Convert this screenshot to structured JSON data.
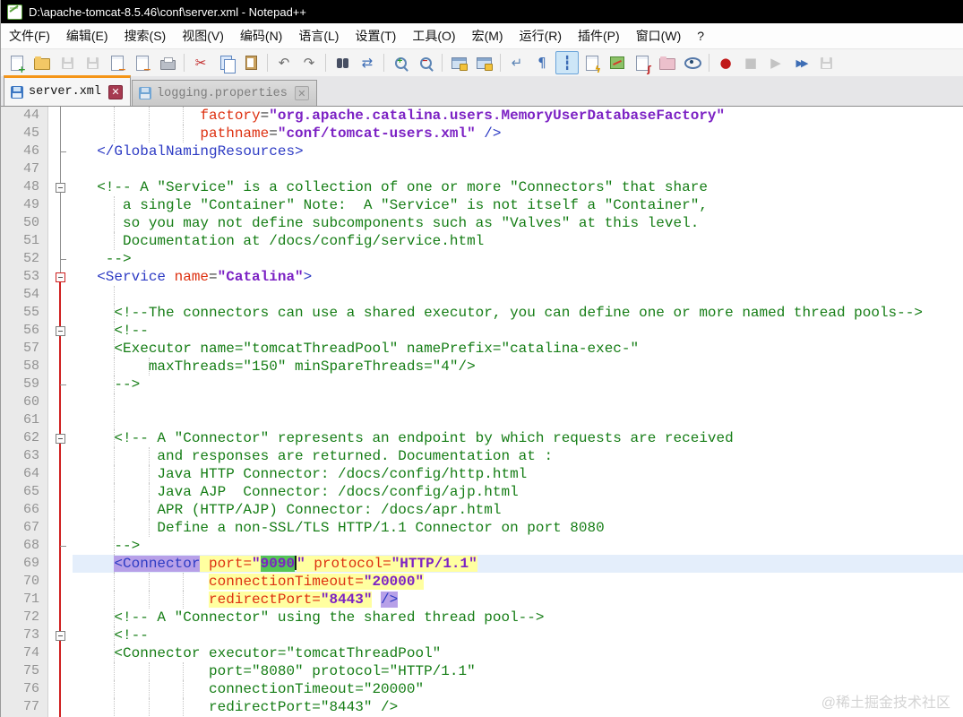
{
  "window": {
    "title": "D:\\apache-tomcat-8.5.46\\conf\\server.xml - Notepad++"
  },
  "menu": {
    "items": [
      "文件(F)",
      "编辑(E)",
      "搜索(S)",
      "视图(V)",
      "编码(N)",
      "语言(L)",
      "设置(T)",
      "工具(O)",
      "宏(M)",
      "运行(R)",
      "插件(P)",
      "窗口(W)",
      "?"
    ]
  },
  "toolbar": {
    "icons": [
      {
        "name": "new-file",
        "kind": "page",
        "glyph": "+",
        "color": "#2f9e2f"
      },
      {
        "name": "open-file",
        "kind": "folder",
        "color": "#f3c865",
        "border": "#b08a2e"
      },
      {
        "name": "save",
        "kind": "floppy",
        "color": "#9aa2ae",
        "disabled": true
      },
      {
        "name": "save-all",
        "kind": "floppy",
        "color": "#9aa2ae",
        "disabled": true
      },
      {
        "name": "close",
        "kind": "page",
        "glyph": "−",
        "color": "#e07818"
      },
      {
        "name": "close-all",
        "kind": "page",
        "glyph": "−",
        "color": "#e07818"
      },
      {
        "name": "print",
        "kind": "printer"
      },
      {
        "kind": "sep"
      },
      {
        "name": "cut",
        "kind": "glyph",
        "glyph": "✂",
        "color": "#c22727"
      },
      {
        "name": "copy",
        "kind": "page2"
      },
      {
        "name": "paste",
        "kind": "clip"
      },
      {
        "kind": "sep"
      },
      {
        "name": "undo",
        "kind": "glyph",
        "glyph": "↶",
        "color": "#6e6e6e"
      },
      {
        "name": "redo",
        "kind": "glyph",
        "glyph": "↷",
        "color": "#6e6e6e"
      },
      {
        "kind": "sep"
      },
      {
        "name": "find",
        "kind": "binoc"
      },
      {
        "name": "replace",
        "kind": "glyph",
        "glyph": "⇄",
        "color": "#3d6db5"
      },
      {
        "kind": "sep"
      },
      {
        "name": "zoom-in",
        "kind": "mag",
        "glyph": "+",
        "color": "#2f9e2f"
      },
      {
        "name": "zoom-out",
        "kind": "mag",
        "glyph": "−",
        "color": "#c22727"
      },
      {
        "kind": "sep"
      },
      {
        "name": "sync-vertical",
        "kind": "win2"
      },
      {
        "name": "sync-horizontal",
        "kind": "win2"
      },
      {
        "kind": "sep"
      },
      {
        "name": "word-wrap",
        "kind": "glyph",
        "glyph": "↵",
        "color": "#5b84b5"
      },
      {
        "name": "show-all-characters",
        "kind": "glyph",
        "glyph": "¶",
        "color": "#3d6db5"
      },
      {
        "name": "indent-guide",
        "kind": "glyph",
        "glyph": "┇",
        "color": "#3d6db5",
        "pressed": true
      },
      {
        "name": "function-list",
        "kind": "page",
        "glyph": "ϟ",
        "color": "#e0a000"
      },
      {
        "name": "document-map",
        "kind": "map"
      },
      {
        "name": "document-list",
        "kind": "page",
        "glyph": "ʃ",
        "color": "#c22727"
      },
      {
        "name": "folder-as-workspace",
        "kind": "folder",
        "color": "#ecc0cc",
        "border": "#b78d9b"
      },
      {
        "name": "monitoring-eye",
        "kind": "eye"
      },
      {
        "kind": "sep"
      },
      {
        "name": "macro-record",
        "kind": "glyph",
        "glyph": "●",
        "color": "#c01818"
      },
      {
        "name": "macro-stop",
        "kind": "glyph",
        "glyph": "■",
        "color": "#8a8a8a",
        "disabled": true
      },
      {
        "name": "macro-play",
        "kind": "glyph",
        "glyph": "▶",
        "color": "#8a8a8a",
        "disabled": true
      },
      {
        "name": "macro-run-multiple",
        "kind": "glyph",
        "glyph": "▶▶",
        "color": "#3d6db5",
        "small": true
      },
      {
        "name": "macro-save",
        "kind": "floppy",
        "color": "#9aa2ae",
        "disabled": true
      }
    ]
  },
  "tabs": [
    {
      "label": "server.xml",
      "active": true
    },
    {
      "label": "logging.properties",
      "active": false
    }
  ],
  "editor": {
    "first_line": 44,
    "colors": {
      "tag": "#2d3bc4",
      "attribute": "#dd3010",
      "value": "#7c22c4",
      "comment": "#157d15",
      "current_line_bg": "#e4eefb",
      "tag_match_bg": "#b7a0e8",
      "tag_zone_bg": "#ffffa0",
      "selection_bg": "#55c455",
      "fold_active": "#cf2020",
      "line_number": "#929292"
    },
    "fold": {
      "gray_line_end_line": 53,
      "red_line_start_line": 53,
      "boxes": [
        {
          "line": 48,
          "color": "gray"
        },
        {
          "line": 53,
          "color": "red"
        },
        {
          "line": 56,
          "color": "gray"
        },
        {
          "line": 62,
          "color": "gray"
        },
        {
          "line": 73,
          "color": "gray"
        }
      ],
      "ticks": [
        46,
        52,
        59,
        68
      ]
    },
    "lines": [
      {
        "n": 44,
        "ind": 14,
        "seg": [
          [
            "              ",
            "d"
          ],
          [
            "factory",
            "a"
          ],
          [
            "=",
            "d"
          ],
          [
            "\"org.apache.catalina.users.MemoryUserDatabaseFactory\"",
            "v"
          ]
        ]
      },
      {
        "n": 45,
        "ind": 14,
        "seg": [
          [
            "              ",
            "d"
          ],
          [
            "pathname",
            "a"
          ],
          [
            "=",
            "d"
          ],
          [
            "\"conf/tomcat-users.xml\"",
            "v"
          ],
          [
            " ",
            "d"
          ],
          [
            "/>",
            "t"
          ]
        ]
      },
      {
        "n": 46,
        "ind": 2,
        "seg": [
          [
            "  ",
            "d"
          ],
          [
            "</GlobalNamingResources>",
            "t"
          ]
        ]
      },
      {
        "n": 47,
        "ind": 0,
        "seg": []
      },
      {
        "n": 48,
        "ind": 2,
        "seg": [
          [
            "  ",
            "d"
          ],
          [
            "<!-- A \"Service\" is a collection of one or more \"Connectors\" that share",
            "c"
          ]
        ]
      },
      {
        "n": 49,
        "ind": 5,
        "seg": [
          [
            "     a single \"Container\" Note:  A \"Service\" is not itself a \"Container\",",
            "c"
          ]
        ]
      },
      {
        "n": 50,
        "ind": 5,
        "seg": [
          [
            "     so you may not define subcomponents such as \"Valves\" at this level.",
            "c"
          ]
        ]
      },
      {
        "n": 51,
        "ind": 5,
        "seg": [
          [
            "     Documentation at /docs/config/service.html",
            "c"
          ]
        ]
      },
      {
        "n": 52,
        "ind": 3,
        "seg": [
          [
            "   -->",
            "c"
          ]
        ]
      },
      {
        "n": 53,
        "ind": 2,
        "seg": [
          [
            "  ",
            "d"
          ],
          [
            "<Service",
            "t"
          ],
          [
            " ",
            "d"
          ],
          [
            "name",
            "a"
          ],
          [
            "=",
            "d"
          ],
          [
            "\"Catalina\"",
            "v"
          ],
          [
            ">",
            "t"
          ]
        ]
      },
      {
        "n": 54,
        "ind": 4,
        "seg": []
      },
      {
        "n": 55,
        "ind": 4,
        "seg": [
          [
            "    ",
            "d"
          ],
          [
            "<!--The connectors can use a shared executor, you can define one or more named thread pools-->",
            "c"
          ]
        ]
      },
      {
        "n": 56,
        "ind": 4,
        "seg": [
          [
            "    ",
            "d"
          ],
          [
            "<!--",
            "c"
          ]
        ]
      },
      {
        "n": 57,
        "ind": 4,
        "seg": [
          [
            "    ",
            "d"
          ],
          [
            "<Executor name=\"tomcatThreadPool\" namePrefix=\"catalina-exec-\"",
            "c"
          ]
        ]
      },
      {
        "n": 58,
        "ind": 8,
        "seg": [
          [
            "        maxThreads=\"150\" minSpareThreads=\"4\"/>",
            "c"
          ]
        ]
      },
      {
        "n": 59,
        "ind": 4,
        "seg": [
          [
            "    ",
            "d"
          ],
          [
            "-->",
            "c"
          ]
        ]
      },
      {
        "n": 60,
        "ind": 4,
        "seg": []
      },
      {
        "n": 61,
        "ind": 4,
        "seg": []
      },
      {
        "n": 62,
        "ind": 4,
        "seg": [
          [
            "    ",
            "d"
          ],
          [
            "<!-- A \"Connector\" represents an endpoint by which requests are received",
            "c"
          ]
        ]
      },
      {
        "n": 63,
        "ind": 9,
        "seg": [
          [
            "         and responses are returned. Documentation at :",
            "c"
          ]
        ]
      },
      {
        "n": 64,
        "ind": 9,
        "seg": [
          [
            "         Java HTTP Connector: /docs/config/http.html",
            "c"
          ]
        ]
      },
      {
        "n": 65,
        "ind": 9,
        "seg": [
          [
            "         Java AJP  Connector: /docs/config/ajp.html",
            "c"
          ]
        ]
      },
      {
        "n": 66,
        "ind": 9,
        "seg": [
          [
            "         APR (HTTP/AJP) Connector: /docs/apr.html",
            "c"
          ]
        ]
      },
      {
        "n": 67,
        "ind": 9,
        "seg": [
          [
            "         Define a non-SSL/TLS HTTP/1.1 Connector on port 8080",
            "c"
          ]
        ]
      },
      {
        "n": 68,
        "ind": 4,
        "seg": [
          [
            "    ",
            "d"
          ],
          [
            "-->",
            "c"
          ]
        ]
      },
      {
        "n": 69,
        "ind": 4,
        "cur": true,
        "seg": [
          [
            "    ",
            "d"
          ],
          [
            "<Connector",
            "t",
            "p"
          ],
          [
            " ",
            "d",
            "y"
          ],
          [
            "port=",
            "a",
            "y"
          ],
          [
            "\"",
            "v",
            "y"
          ],
          [
            "9090",
            "v",
            "g"
          ],
          [
            "",
            "caret"
          ],
          [
            "\"",
            "v",
            "y"
          ],
          [
            " ",
            "d",
            "y"
          ],
          [
            "protocol=",
            "a",
            "y"
          ],
          [
            "\"HTTP/1.1\"",
            "v",
            "y"
          ]
        ]
      },
      {
        "n": 70,
        "ind": 15,
        "seg": [
          [
            "               ",
            "d"
          ],
          [
            "connectionTimeout=",
            "a",
            "y"
          ],
          [
            "\"20000\"",
            "v",
            "y"
          ]
        ]
      },
      {
        "n": 71,
        "ind": 15,
        "seg": [
          [
            "               ",
            "d"
          ],
          [
            "redirectPort=",
            "a",
            "y"
          ],
          [
            "\"8443\"",
            "v",
            "y"
          ],
          [
            " ",
            "d"
          ],
          [
            "/>",
            "t",
            "p"
          ]
        ]
      },
      {
        "n": 72,
        "ind": 4,
        "seg": [
          [
            "    ",
            "d"
          ],
          [
            "<!-- A \"Connector\" using the shared thread pool-->",
            "c"
          ]
        ]
      },
      {
        "n": 73,
        "ind": 4,
        "seg": [
          [
            "    ",
            "d"
          ],
          [
            "<!--",
            "c"
          ]
        ]
      },
      {
        "n": 74,
        "ind": 4,
        "seg": [
          [
            "    ",
            "d"
          ],
          [
            "<Connector executor=\"tomcatThreadPool\"",
            "c"
          ]
        ]
      },
      {
        "n": 75,
        "ind": 15,
        "seg": [
          [
            "               port=\"8080\" protocol=\"HTTP/1.1\"",
            "c"
          ]
        ]
      },
      {
        "n": 76,
        "ind": 15,
        "seg": [
          [
            "               connectionTimeout=\"20000\"",
            "c"
          ]
        ]
      },
      {
        "n": 77,
        "ind": 15,
        "seg": [
          [
            "               redirectPort=\"8443\" />",
            "c"
          ]
        ]
      }
    ]
  },
  "watermark": {
    "text": "@稀土掘金技术社区"
  }
}
